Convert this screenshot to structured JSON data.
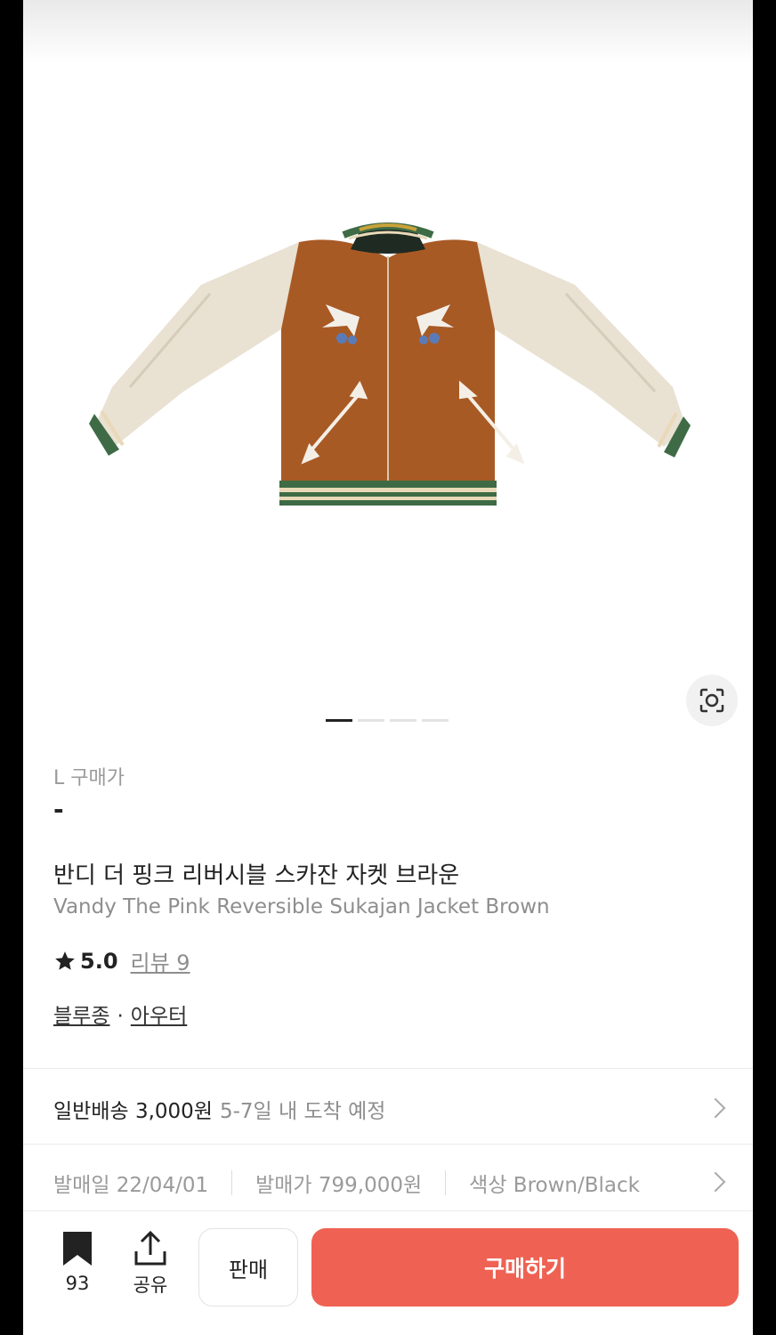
{
  "product": {
    "size_label": "L 구매가",
    "price": "-",
    "name_ko": "반디 더 핑크 리버시블 스카잔 자켓 브라운",
    "name_en": "Vandy The Pink Reversible Sukajan Jacket Brown",
    "rating": "5.0",
    "review_label": "리뷰 9",
    "categories": [
      "블루종",
      "아우터"
    ],
    "category_sep": "·"
  },
  "gallery": {
    "slide_count": 4,
    "active_index": 0,
    "lens_icon": "lens-icon",
    "image": "jacket-image"
  },
  "shipping": {
    "label": "일반배송 3,000원",
    "eta": "5-7일 내 도착 예정"
  },
  "info": {
    "release_date": "발매일 22/04/01",
    "release_price": "발매가 799,000원",
    "color": "색상 Brown/Black"
  },
  "bottom_bar": {
    "bookmark_count": "93",
    "share_label": "공유",
    "sell_label": "판매",
    "buy_label": "구매하기"
  },
  "colors": {
    "buy_button": "#ef6253",
    "jacket_body": "#a85a25",
    "jacket_sleeve": "#e9e1d2",
    "rib_green": "#3e6b45"
  }
}
